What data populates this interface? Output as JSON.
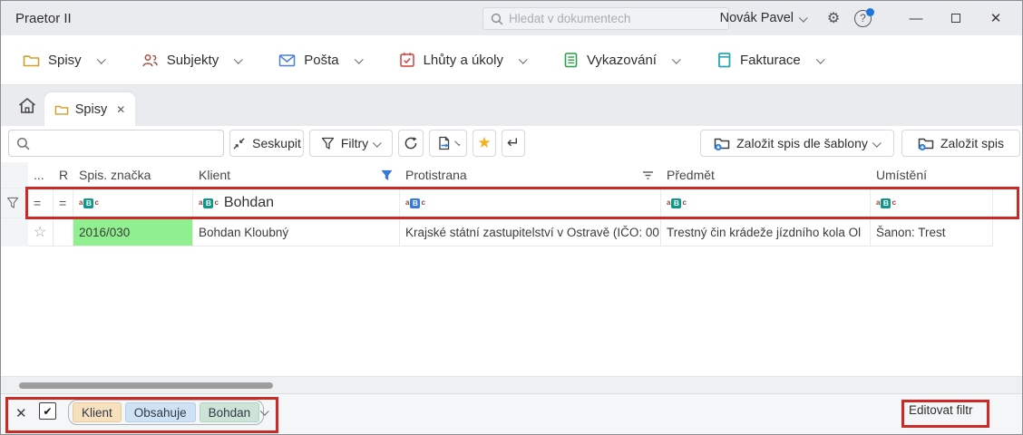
{
  "window": {
    "title": "Praetor II",
    "user": "Novák Pavel",
    "search": {
      "placeholder": "Hledat v dokumentech",
      "value": ""
    }
  },
  "icons": {
    "gear": "⚙",
    "help": "?",
    "minimize": "—",
    "close": "✕",
    "star": "★",
    "star_outline": "☆",
    "enter": "↵",
    "check": "✔",
    "clear": "✕",
    "tab_close": "✕",
    "abc_a": "a",
    "abc_b": "B",
    "abc_c": "c"
  },
  "menu": {
    "items": [
      {
        "label": "Spisy"
      },
      {
        "label": "Subjekty"
      },
      {
        "label": "Pošta"
      },
      {
        "label": "Lhůty a úkoly"
      },
      {
        "label": "Vykazování"
      },
      {
        "label": "Fakturace"
      }
    ]
  },
  "tabs": {
    "active_label": "Spisy"
  },
  "toolbar": {
    "search_value": "",
    "group": "Seskupit",
    "filters": "Filtry",
    "new_by_template": "Založit spis dle šablony",
    "new_file": "Založit spis"
  },
  "table": {
    "columns": [
      "...",
      "R",
      "Spis. značka",
      "Klient",
      "Protistrana",
      "Předmět",
      "Umístění"
    ],
    "filter_row": {
      "dots": "=",
      "r": "=",
      "klient_value": "Bohdan"
    },
    "rows": [
      {
        "spis_znacka": "2016/030",
        "klient": "Bohdan Kloubný",
        "protistrana": "Krajské státní zastupitelství v Ostravě (IČO: 00",
        "predmet": "Trestný čin krádeže jízdního kola Ol",
        "umisteni": "Šanon: Trest"
      }
    ]
  },
  "filter_bar": {
    "chips": [
      {
        "label": "Klient"
      },
      {
        "label": "Obsahuje"
      },
      {
        "label": "Bohdan"
      }
    ],
    "edit_button": "Editovat filtr"
  },
  "colors": {
    "annotation_red": "#cb2a27",
    "row_highlight_green": "#90f08f",
    "abc_teal": "#0f9688",
    "abc_blue": "#3779d9",
    "chip_klient": "#f7e0bd",
    "chip_obsahuje": "#cfe2f3",
    "chip_bohdan": "#cde3d8",
    "star_gold": "#f2b01e"
  }
}
